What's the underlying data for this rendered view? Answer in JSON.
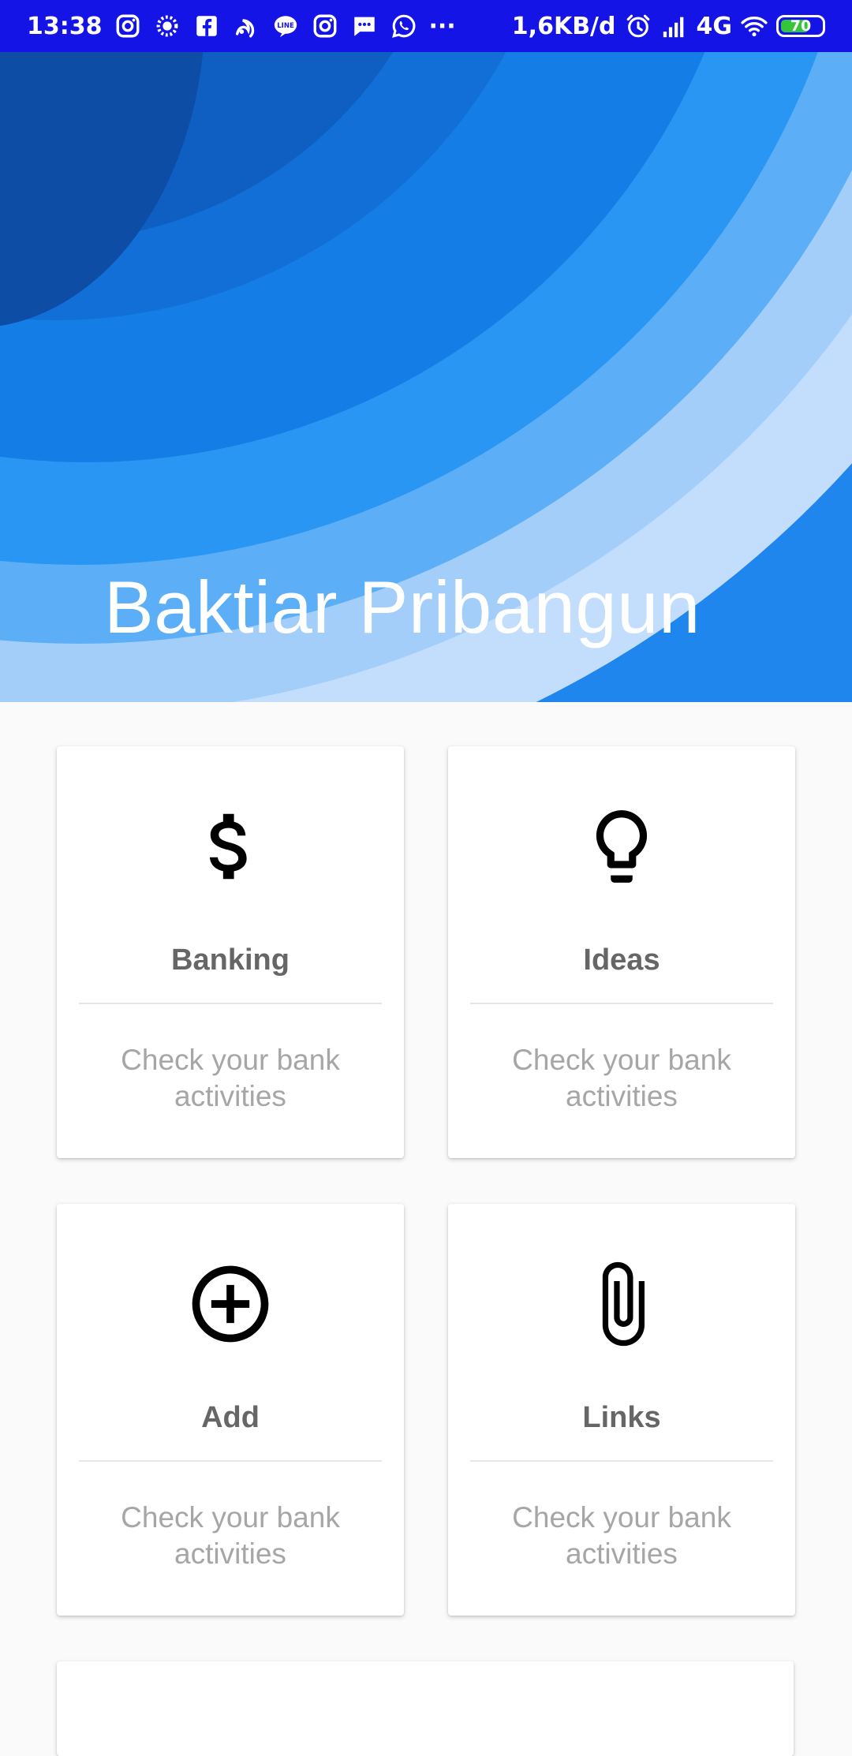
{
  "status_bar": {
    "time": "13:38",
    "left_icons": [
      "instagram-icon",
      "spinner-icon",
      "facebook-icon",
      "uc-browser-icon",
      "line-icon",
      "instagram-icon",
      "message-icon",
      "whatsapp-icon",
      "more-icon"
    ],
    "more_label": "···",
    "network_speed": "1,6KB/d",
    "network_type": "4G",
    "battery_level": "70",
    "battery_fraction": 0.7,
    "bar_color": "#1414e6"
  },
  "header": {
    "title": "Baktiar Pribangun"
  },
  "cards": [
    {
      "icon": "dollar-icon",
      "title": "Banking",
      "description": "Check your bank activities"
    },
    {
      "icon": "lightbulb-icon",
      "title": "Ideas",
      "description": "Check your bank activities"
    },
    {
      "icon": "add-circle-icon",
      "title": "Add",
      "description": "Check your bank activities"
    },
    {
      "icon": "paperclip-icon",
      "title": "Links",
      "description": "Check your bank activities"
    }
  ]
}
